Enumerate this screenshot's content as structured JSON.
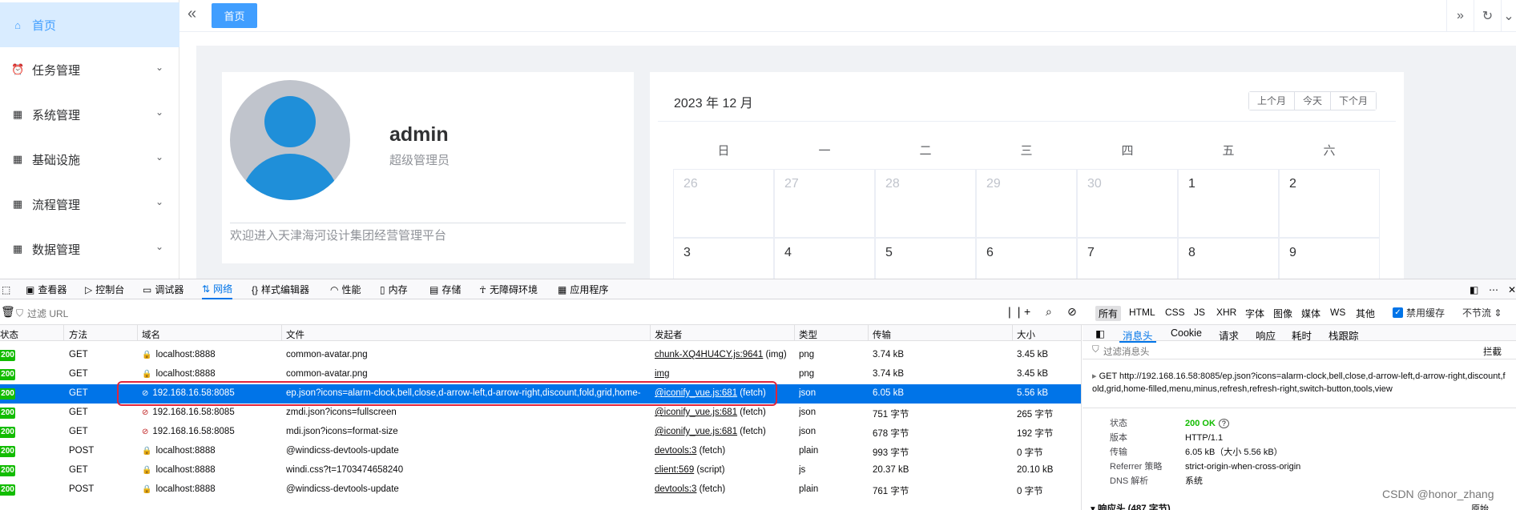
{
  "sidebar": {
    "items": [
      {
        "label": "首页",
        "icon": "home-icon"
      },
      {
        "label": "任务管理",
        "icon": "alarm-clock-icon"
      },
      {
        "label": "系统管理",
        "icon": "grid-icon"
      },
      {
        "label": "基础设施",
        "icon": "grid-icon"
      },
      {
        "label": "流程管理",
        "icon": "grid-icon"
      },
      {
        "label": "数据管理",
        "icon": "grid-icon"
      }
    ]
  },
  "topbar": {
    "tab_label": "首页"
  },
  "user_card": {
    "name": "admin",
    "role": "超级管理员",
    "welcome": "欢迎进入天津海河设计集团经营管理平台"
  },
  "calendar": {
    "title": "2023 年 12 月",
    "prev_label": "上个月",
    "today_label": "今天",
    "next_label": "下个月",
    "weekdays": [
      "日",
      "一",
      "二",
      "三",
      "四",
      "五",
      "六"
    ],
    "row1": [
      "26",
      "27",
      "28",
      "29",
      "30",
      "1",
      "2"
    ],
    "row2": [
      "3",
      "4",
      "5",
      "6",
      "7",
      "8",
      "9"
    ]
  },
  "devtools": {
    "tabs": [
      "查看器",
      "控制台",
      "调试器",
      "网络",
      "样式编辑器",
      "性能",
      "内存",
      "存储",
      "无障碍环境",
      "应用程序"
    ],
    "filter_placeholder": "过滤 URL",
    "type_filters": [
      "所有",
      "HTML",
      "CSS",
      "JS",
      "XHR",
      "字体",
      "图像",
      "媒体",
      "WS",
      "其他"
    ],
    "disable_cache_label": "禁用缓存",
    "throttle_label": "不节流 ⇕",
    "columns": [
      "状态",
      "方法",
      "域名",
      "文件",
      "发起者",
      "类型",
      "传输",
      "大小"
    ],
    "requests": [
      {
        "status": "200",
        "method": "GET",
        "domain": "localhost:8888",
        "file": "common-avatar.png",
        "initiator": "chunk-XQ4HU4CY.js:9641",
        "initiator_suffix": " (img)",
        "type": "png",
        "transfer": "3.74 kB",
        "size": "3.45 kB"
      },
      {
        "status": "200",
        "method": "GET",
        "domain": "localhost:8888",
        "file": "common-avatar.png",
        "initiator": "img",
        "initiator_suffix": "",
        "type": "png",
        "transfer": "3.74 kB",
        "size": "3.45 kB"
      },
      {
        "status": "200",
        "method": "GET",
        "domain": "192.168.16.58:8085",
        "file": "ep.json?icons=alarm-clock,bell,close,d-arrow-left,d-arrow-right,discount,fold,grid,home-",
        "initiator": "@iconify_vue.js:681",
        "initiator_suffix": " (fetch)",
        "type": "json",
        "transfer": "6.05 kB",
        "size": "5.56 kB"
      },
      {
        "status": "200",
        "method": "GET",
        "domain": "192.168.16.58:8085",
        "file": "zmdi.json?icons=fullscreen",
        "initiator": "@iconify_vue.js:681",
        "initiator_suffix": " (fetch)",
        "type": "json",
        "transfer": "751 字节",
        "size": "265 字节"
      },
      {
        "status": "200",
        "method": "GET",
        "domain": "192.168.16.58:8085",
        "file": "mdi.json?icons=format-size",
        "initiator": "@iconify_vue.js:681",
        "initiator_suffix": " (fetch)",
        "type": "json",
        "transfer": "678 字节",
        "size": "192 字节"
      },
      {
        "status": "200",
        "method": "POST",
        "domain": "localhost:8888",
        "file": "@windicss-devtools-update",
        "initiator": "devtools:3",
        "initiator_suffix": " (fetch)",
        "type": "plain",
        "transfer": "993 字节",
        "size": "0 字节"
      },
      {
        "status": "200",
        "method": "GET",
        "domain": "localhost:8888",
        "file": "windi.css?t=1703474658240",
        "initiator": "client:569",
        "initiator_suffix": " (script)",
        "type": "js",
        "transfer": "20.37 kB",
        "size": "20.10 kB"
      },
      {
        "status": "200",
        "method": "POST",
        "domain": "localhost:8888",
        "file": "@windicss-devtools-update",
        "initiator": "devtools:3",
        "initiator_suffix": " (fetch)",
        "type": "plain",
        "transfer": "761 字节",
        "size": "0 字节"
      }
    ],
    "details": {
      "tabs": [
        "消息头",
        "Cookie",
        "请求",
        "响应",
        "耗时",
        "栈跟踪"
      ],
      "filter_placeholder": "过滤消息头",
      "block_label": "拦截",
      "url_line": "GET http://192.168.16.58:8085/ep.json?icons=alarm-clock,bell,close,d-arrow-left,d-arrow-right,discount,fold,grid,home-filled,menu,minus,refresh,refresh-right,switch-button,tools,view",
      "fields": [
        {
          "key": "状态",
          "value": "200 OK"
        },
        {
          "key": "版本",
          "value": "HTTP/1.1"
        },
        {
          "key": "传输",
          "value": "6.05 kB（大小 5.56 kB）"
        },
        {
          "key": "Referrer 策略",
          "value": "strict-origin-when-cross-origin"
        },
        {
          "key": "DNS 解析",
          "value": "系统"
        }
      ],
      "response_header_label": "▾ 响应头 (487 字节)",
      "raw_label": "原始"
    }
  },
  "watermark": "CSDN @honor_zhang"
}
